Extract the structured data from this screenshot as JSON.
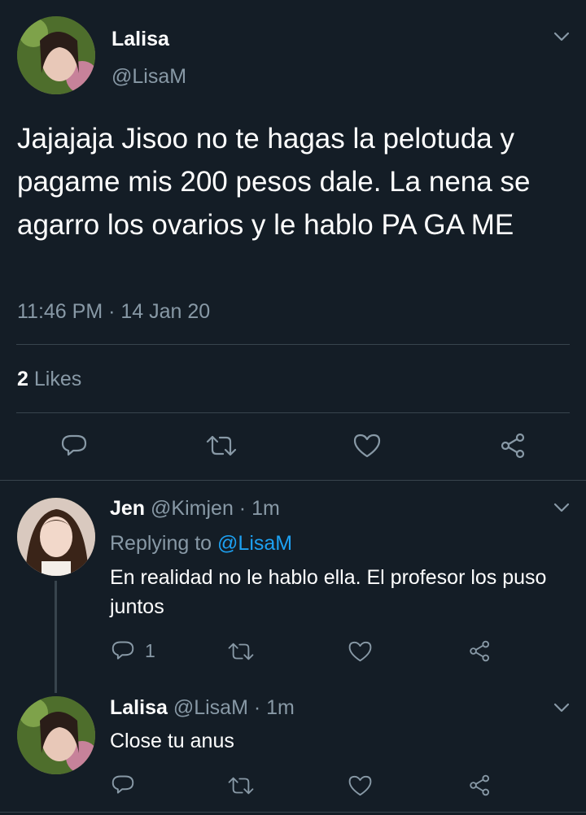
{
  "main_tweet": {
    "display_name": "Lalisa",
    "handle": "@LisaM",
    "text": "Jajajaja Jisoo no te hagas la pelotuda y pagame mis 200 pesos dale. La nena se agarro los ovarios y le hablo PA GA ME",
    "timestamp": "11:46 PM · 14 Jan 20",
    "likes_count": "2",
    "likes_label": "Likes"
  },
  "replies": [
    {
      "display_name": "Jen",
      "handle": "@Kimjen",
      "time": "· 1m",
      "replying_to_label": "Replying to",
      "replying_to_handle": "@LisaM",
      "text": "En realidad no le hablo ella. El profesor los puso juntos",
      "reply_count": "1"
    },
    {
      "display_name": "Lalisa",
      "handle": "@LisaM",
      "time": "· 1m",
      "text": "Close tu anus"
    }
  ],
  "icons": {
    "reply": "reply-icon",
    "retweet": "retweet-icon",
    "like": "heart-icon",
    "share": "share-icon",
    "more": "chevron-down-icon"
  },
  "colors": {
    "background": "#141d26",
    "text": "#ffffff",
    "muted": "#8899a6",
    "link": "#1da1f2",
    "divider": "#38444d"
  }
}
